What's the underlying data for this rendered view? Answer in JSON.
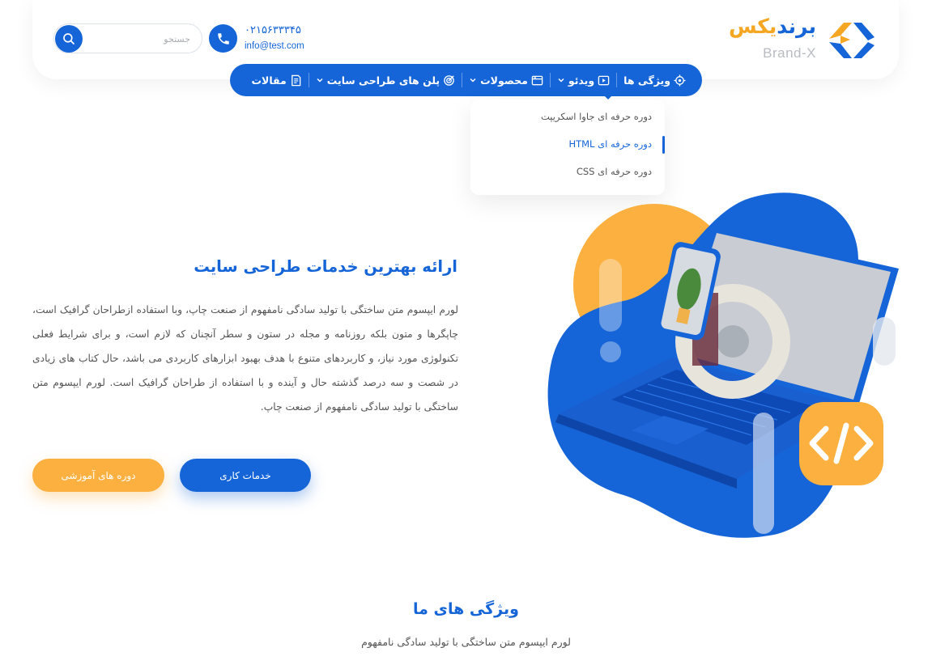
{
  "header": {
    "brand_fa_part1": "برند",
    "brand_fa_part2": "یکس",
    "brand_en": "Brand-X",
    "phone": "۰۲۱۵۶۳۳۳۴۵",
    "email": "info@test.com",
    "search_placeholder": "جستجو"
  },
  "nav": {
    "items": [
      {
        "label": "ویژگی ها",
        "icon": "target-icon",
        "has_dropdown": false
      },
      {
        "label": "ویدئو",
        "icon": "video-icon",
        "has_dropdown": true
      },
      {
        "label": "محصولات",
        "icon": "window-icon",
        "has_dropdown": true
      },
      {
        "label": "پلن های طراحی سایت",
        "icon": "dart-icon",
        "has_dropdown": true
      },
      {
        "label": "مقالات",
        "icon": "document-icon",
        "has_dropdown": false
      }
    ]
  },
  "dropdown": {
    "items": [
      {
        "label": "دوره حرفه ای جاوا اسکریپت",
        "active": false
      },
      {
        "label": "دوره حرفه ای HTML",
        "active": true
      },
      {
        "label": "دوره حرفه ای CSS",
        "active": false
      }
    ]
  },
  "hero": {
    "title": "ارائه بهترین خدمات طراحی سایت",
    "text": "لورم ایپسوم متن ساختگی با تولید سادگی نامفهوم از صنعت چاپ، وبا استفاده ازطراحان گرافیک است، چاپگرها و متون بلکه روزنامه و مجله در ستون و سطر آنچنان که لازم است، و برای شرایط فعلی تکنولوژی مورد نیاز، و کاربردهای متنوع با هدف بهبود ابزارهای کاربردی می باشد، حال کتاب های زیادی در شصت و سه درصد گذشته حال و آینده و با استفاده از طراحان گرافیک است. لورم ایپسوم متن ساختگی با تولید سادگی نامفهوم از صنعت چاپ.",
    "primary_button": "خدمات کاری",
    "secondary_button": "دوره های آموزشی"
  },
  "features": {
    "title": "ویژگی های ما",
    "subtitle": "لورم ایپسوم متن ساختگی با تولید سادگی نامفهوم"
  },
  "colors": {
    "primary": "#1565d8",
    "accent": "#fbb040"
  }
}
